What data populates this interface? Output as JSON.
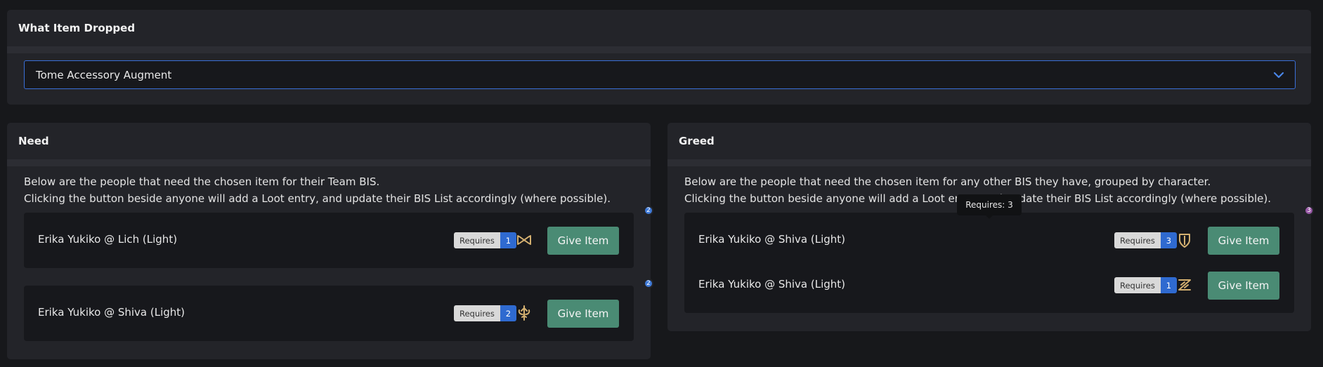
{
  "drop": {
    "title": "What Item Dropped",
    "selected": "Tome Accessory Augment"
  },
  "need": {
    "title": "Need",
    "desc_line1": "Below are the people that need the chosen item for their Team BIS.",
    "desc_line2": "Clicking the button beside anyone will add a Loot entry, and update their BIS List accordingly (where possible).",
    "rows": [
      {
        "name": "Erika Yukiko @ Lich (Light)",
        "requires_label": "Requires",
        "requires_count": "1",
        "badge": "2",
        "button": "Give Item",
        "job_icon": "reaper-job-icon"
      },
      {
        "name": "Erika Yukiko @ Shiva (Light)",
        "requires_label": "Requires",
        "requires_count": "2",
        "badge": "2",
        "button": "Give Item",
        "job_icon": "sage-job-icon"
      }
    ]
  },
  "greed": {
    "title": "Greed",
    "desc_line1": "Below are the people that need the chosen item for any other BIS they have, grouped by character.",
    "desc_line2": "Clicking the button beside anyone will add a Loot entry, and update their BIS List accordingly (where possible).",
    "badge": "3",
    "rows": [
      {
        "name": "Erika Yukiko @ Shiva (Light)",
        "requires_label": "Requires",
        "requires_count": "3",
        "button": "Give Item",
        "job_icon": "paladin-job-icon"
      },
      {
        "name": "Erika Yukiko @ Shiva (Light)",
        "requires_label": "Requires",
        "requires_count": "1",
        "button": "Give Item",
        "job_icon": "dragoon-job-icon"
      }
    ]
  },
  "tooltip": {
    "text": "Requires: 3"
  },
  "colors": {
    "accent_blue": "#2f6ad0",
    "button_green": "#4a8b74",
    "icon_gold": "#d4b070",
    "badge_purple": "#9a5aa8"
  }
}
